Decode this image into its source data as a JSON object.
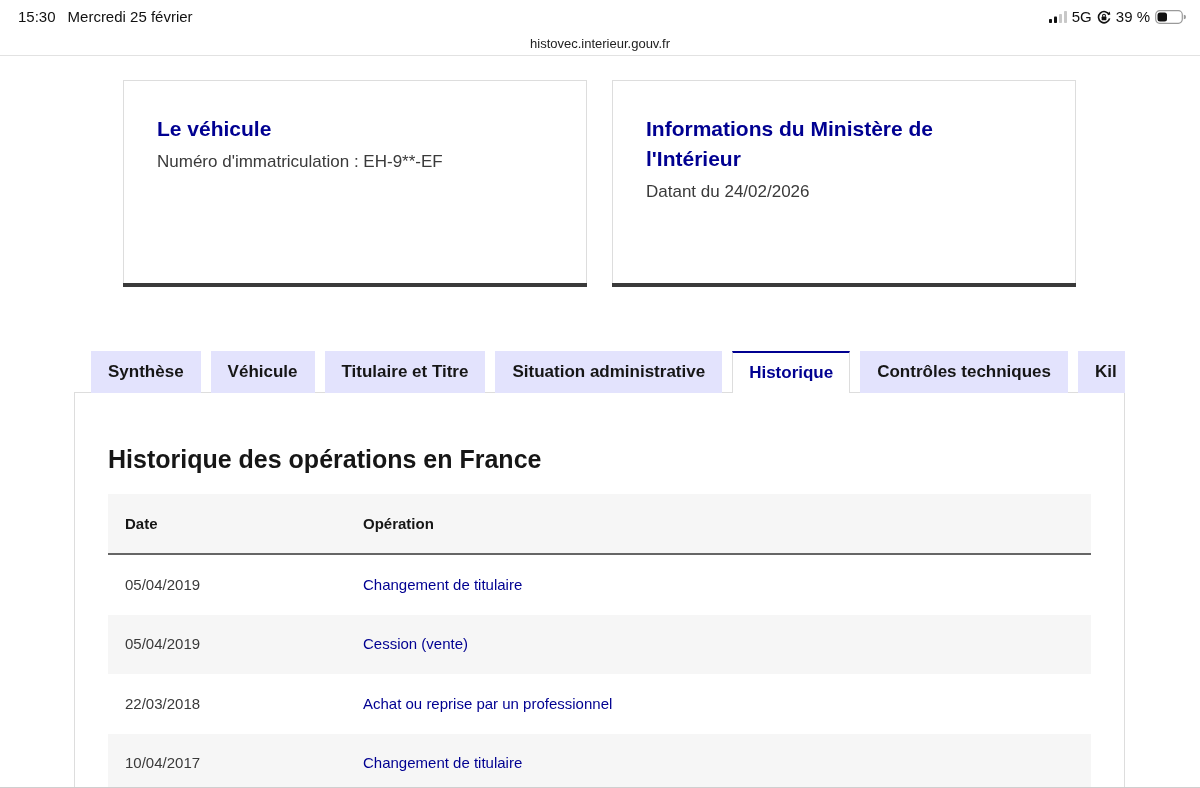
{
  "status_bar": {
    "time": "15:30",
    "date": "Mercredi 25 février",
    "network": "5G",
    "battery": "39 %"
  },
  "address_bar": {
    "url": "histovec.interieur.gouv.fr"
  },
  "cards": [
    {
      "title": "Le véhicule",
      "text": "Numéro d'immatriculation : EH-9**-EF"
    },
    {
      "title": "Informations du Ministère de l'Intérieur",
      "text": "Datant du 24/02/2026"
    }
  ],
  "tabs": [
    {
      "label": "Synthèse",
      "selected": false
    },
    {
      "label": "Véhicule",
      "selected": false
    },
    {
      "label": "Titulaire et Titre",
      "selected": false
    },
    {
      "label": "Situation administrative",
      "selected": false
    },
    {
      "label": "Historique",
      "selected": true
    },
    {
      "label": "Contrôles techniques",
      "selected": false
    },
    {
      "label": "Kil",
      "selected": false
    }
  ],
  "panel": {
    "heading": "Historique des opérations en France",
    "table": {
      "columns": [
        "Date",
        "Opération"
      ],
      "rows": [
        [
          "05/04/2019",
          "Changement de titulaire"
        ],
        [
          "05/04/2019",
          "Cession (vente)"
        ],
        [
          "22/03/2018",
          "Achat ou reprise par un professionnel"
        ],
        [
          "10/04/2017",
          "Changement de titulaire"
        ]
      ]
    }
  }
}
